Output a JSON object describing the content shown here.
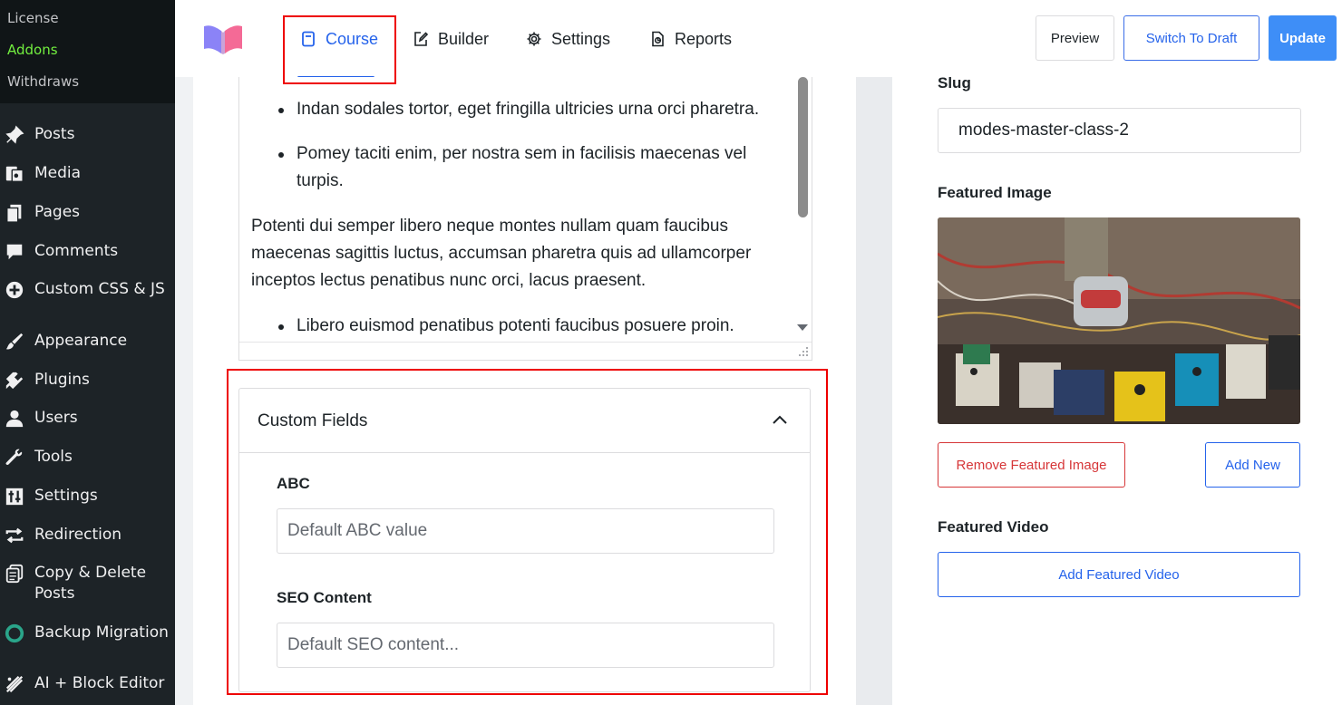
{
  "sidebar": {
    "submenu": [
      {
        "label": "License",
        "active": false
      },
      {
        "label": "Addons",
        "active": true
      },
      {
        "label": "Withdraws",
        "active": false
      }
    ],
    "items": [
      {
        "label": "Posts",
        "icon": "pushpin-icon"
      },
      {
        "label": "Media",
        "icon": "media-icon"
      },
      {
        "label": "Pages",
        "icon": "pages-icon"
      },
      {
        "label": "Comments",
        "icon": "comment-icon"
      },
      {
        "label": "Custom CSS & JS",
        "icon": "plus-circle-icon"
      },
      {
        "label": "Appearance",
        "icon": "paintbrush-icon"
      },
      {
        "label": "Plugins",
        "icon": "plugin-icon"
      },
      {
        "label": "Users",
        "icon": "user-icon"
      },
      {
        "label": "Tools",
        "icon": "wrench-icon"
      },
      {
        "label": "Settings",
        "icon": "sliders-icon"
      },
      {
        "label": "Redirection",
        "icon": "redirect-arrows-icon"
      },
      {
        "label": "Copy & Delete\nPosts",
        "line1": "Copy & Delete",
        "line2": "Posts",
        "icon": "copy-icon"
      },
      {
        "label": "Backup Migration",
        "icon": "backup-icon"
      },
      {
        "label": "AI + Block Editor",
        "icon": "ai-icon"
      }
    ],
    "accent_active": "#72ee3f"
  },
  "header": {
    "tabs": [
      {
        "label": "Course",
        "icon": "course-icon",
        "active": true
      },
      {
        "label": "Builder",
        "icon": "edit-icon",
        "active": false
      },
      {
        "label": "Settings",
        "icon": "gear-icon",
        "active": false
      },
      {
        "label": "Reports",
        "icon": "reports-icon",
        "active": false
      }
    ],
    "buttons": {
      "preview": "Preview",
      "switch_draft": "Switch To Draft",
      "update": "Update"
    },
    "accent": "#2563eb"
  },
  "editor": {
    "bullets_top": [
      "Indan sodales tortor, eget fringilla ultricies urna orci pharetra.",
      "Pomey taciti enim, per nostra sem in facilisis maecenas vel",
      "turpis."
    ],
    "paragraph": [
      "Potenti dui semper libero neque montes nullam quam faucibus",
      "maecenas sagittis luctus, accumsan pharetra quis ad ullamcorper",
      "inceptos lectus penatibus nunc orci, lacus praesent."
    ],
    "bullets_bottom": [
      "Libero euismod penatibus potenti faucibus posuere proin."
    ]
  },
  "custom_fields": {
    "title": "Custom Fields",
    "fields": [
      {
        "label": "ABC",
        "placeholder": "Default ABC value"
      },
      {
        "label": "SEO Content",
        "placeholder": "Default SEO content..."
      }
    ]
  },
  "right_panel": {
    "slug_label": "Slug",
    "slug_value": "modes-master-class-2",
    "featured_image_label": "Featured Image",
    "remove_featured_image": "Remove Featured Image",
    "add_new": "Add New",
    "featured_video_label": "Featured Video",
    "add_featured_video": "Add Featured Video",
    "danger_color": "#d63638"
  }
}
